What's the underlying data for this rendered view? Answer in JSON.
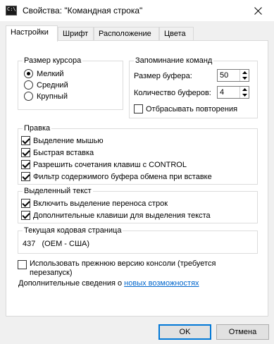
{
  "window": {
    "title": "Свойства: \"Командная строка\"",
    "icon": "console-icon"
  },
  "tabs": [
    {
      "label": "Настройки",
      "active": true
    },
    {
      "label": "Шрифт",
      "active": false
    },
    {
      "label": "Расположение",
      "active": false
    },
    {
      "label": "Цвета",
      "active": false
    }
  ],
  "cursor_size": {
    "title": "Размер курсора",
    "options": [
      {
        "label": "Мелкий",
        "selected": true
      },
      {
        "label": "Средний",
        "selected": false
      },
      {
        "label": "Крупный",
        "selected": false
      }
    ]
  },
  "command_history": {
    "title": "Запоминание команд",
    "buffer_size_label": "Размер буфера:",
    "buffer_size_value": "50",
    "buffer_count_label": "Количество буферов:",
    "buffer_count_value": "4",
    "discard_duplicates_label": "Отбрасывать повторения",
    "discard_duplicates_checked": false
  },
  "edit_options": {
    "title": "Правка",
    "items": [
      {
        "label": "Выделение мышью",
        "checked": true
      },
      {
        "label": "Быстрая вставка",
        "checked": true
      },
      {
        "label": "Разрешить сочетания клавиш с CONTROL",
        "checked": true
      },
      {
        "label": "Фильтр содержимого буфера обмена при вставке",
        "checked": true
      }
    ]
  },
  "text_selection": {
    "title": "Выделенный текст",
    "items": [
      {
        "label": "Включить выделение переноса строк",
        "checked": true
      },
      {
        "label": "Дополнительные клавиши для выделения текста",
        "checked": true
      }
    ]
  },
  "codepage": {
    "title": "Текущая кодовая страница",
    "value": "437   (OEM - США)"
  },
  "legacy_console": {
    "label_line1": "Использовать прежнюю версию консоли (требуется",
    "label_line2": "перезапуск)",
    "checked": false
  },
  "more_info": {
    "text": "Дополнительные сведения о ",
    "link": "новых возможностях"
  },
  "buttons": {
    "ok": "OK",
    "cancel": "Отмена"
  }
}
